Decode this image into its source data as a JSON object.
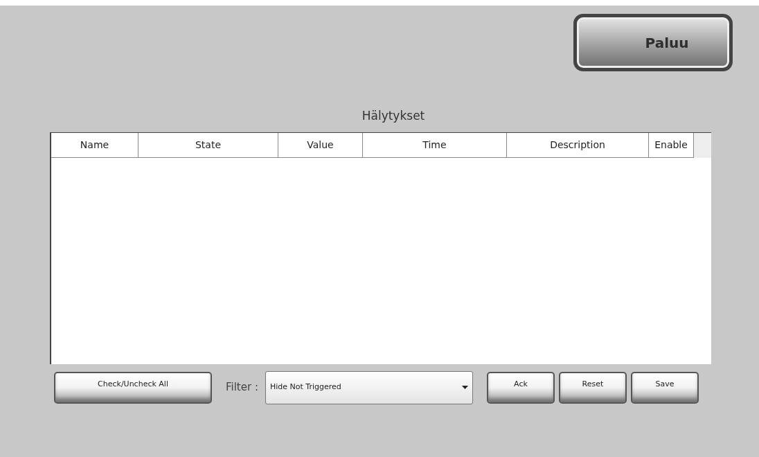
{
  "back_button": {
    "label": "Paluu"
  },
  "title": "Hälytykset",
  "table": {
    "columns": [
      "Name",
      "State",
      "Value",
      "Time",
      "Description",
      "Enable"
    ]
  },
  "check_all_button": {
    "label": "Check/Uncheck All"
  },
  "filter": {
    "label": "Filter :",
    "value": "Hide Not Triggered"
  },
  "buttons": [
    "Ack",
    "Reset",
    "Save"
  ]
}
